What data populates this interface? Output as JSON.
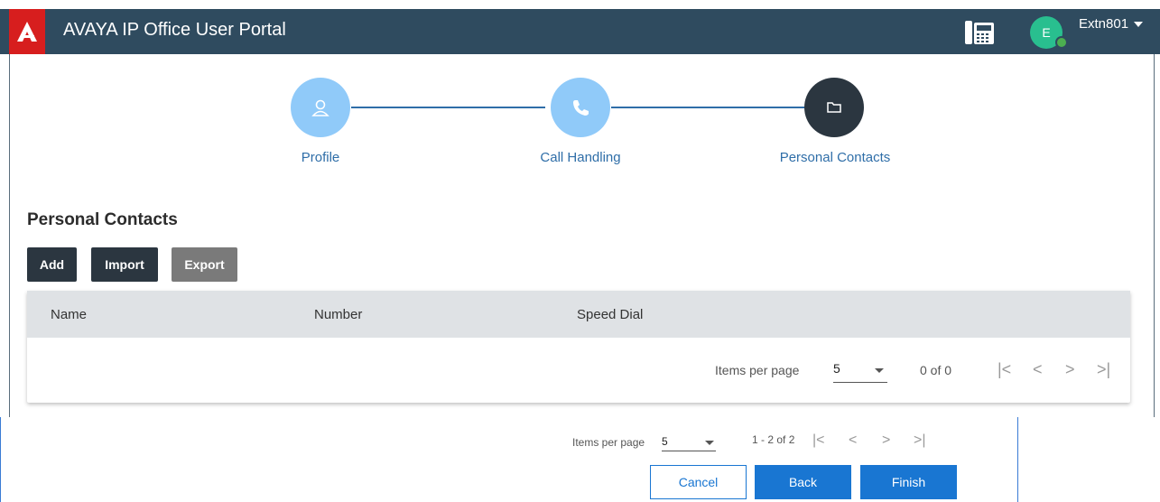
{
  "header": {
    "title": "AVAYA IP Office User Portal",
    "avatar_initial": "E",
    "user": "Extn801"
  },
  "stepper": {
    "steps": [
      {
        "label": "Profile",
        "icon": "user-icon",
        "state": "done"
      },
      {
        "label": "Call Handling",
        "icon": "phone-icon",
        "state": "done"
      },
      {
        "label": "Personal Contacts",
        "icon": "folder-icon",
        "state": "active"
      }
    ]
  },
  "section": {
    "title": "Personal Contacts",
    "buttons": {
      "add": "Add",
      "import": "Import",
      "export": "Export"
    }
  },
  "table": {
    "columns": [
      "Name",
      "Number",
      "Speed Dial"
    ],
    "pager": {
      "items_label": "Items per page",
      "items_value": "5",
      "range": "0 of 0"
    }
  },
  "footer_pager": {
    "items_label": "Items per page",
    "items_value": "5",
    "range": "1 - 2 of 2"
  },
  "footer_buttons": {
    "cancel": "Cancel",
    "back": "Back",
    "finish": "Finish"
  },
  "colors": {
    "header_bg": "#2f4b5f",
    "logo_red": "#d71e1e",
    "step_light": "#90caf9",
    "step_dark": "#2b3640",
    "link_blue": "#2f6ea8",
    "primary_blue": "#1976d2"
  }
}
